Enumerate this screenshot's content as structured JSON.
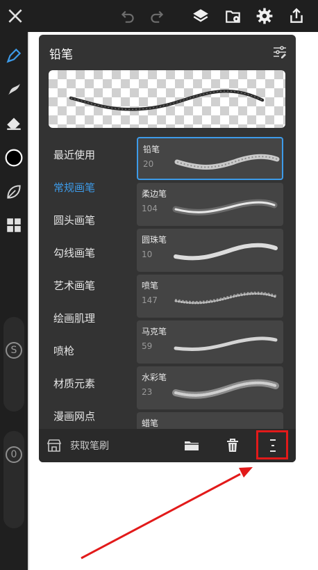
{
  "panel": {
    "title": "铅笔"
  },
  "categories": [
    {
      "label": "最近使用",
      "active": false
    },
    {
      "label": "常规画笔",
      "active": true
    },
    {
      "label": "圆头画笔",
      "active": false
    },
    {
      "label": "勾线画笔",
      "active": false
    },
    {
      "label": "艺术画笔",
      "active": false
    },
    {
      "label": "绘画肌理",
      "active": false
    },
    {
      "label": "喷枪",
      "active": false
    },
    {
      "label": "材质元素",
      "active": false
    },
    {
      "label": "漫画网点",
      "active": false
    }
  ],
  "brushes": [
    {
      "name": "铅笔",
      "size": "20",
      "selected": true
    },
    {
      "name": "柔边笔",
      "size": "104",
      "selected": false
    },
    {
      "name": "圆珠笔",
      "size": "10",
      "selected": false
    },
    {
      "name": "喷笔",
      "size": "147",
      "selected": false
    },
    {
      "name": "马克笔",
      "size": "59",
      "selected": false
    },
    {
      "name": "水彩笔",
      "size": "23",
      "selected": false
    },
    {
      "name": "蜡笔",
      "size": "",
      "selected": false
    }
  ],
  "footer": {
    "get_brush_label": "获取笔刷"
  },
  "pills": {
    "top_badge": "S",
    "bottom_badge": "0"
  },
  "colors": {
    "accent": "#3d9be9",
    "panel_bg": "#333333",
    "toolbar_bg": "#1f1f1f",
    "highlight": "#e21a1a"
  },
  "icons": {
    "topbar": [
      "close-icon",
      "undo-icon",
      "redo-icon",
      "layers-icon",
      "import-icon",
      "settings-gear-icon",
      "share-icon"
    ],
    "leftbar": [
      "brush-pen-icon",
      "smudge-icon",
      "eraser-icon",
      "color-swatch-icon",
      "leaf-icon",
      "grid-menu-icon"
    ],
    "footer": [
      "store-icon",
      "folder-icon",
      "trash-icon",
      "more-menu-icon"
    ]
  }
}
